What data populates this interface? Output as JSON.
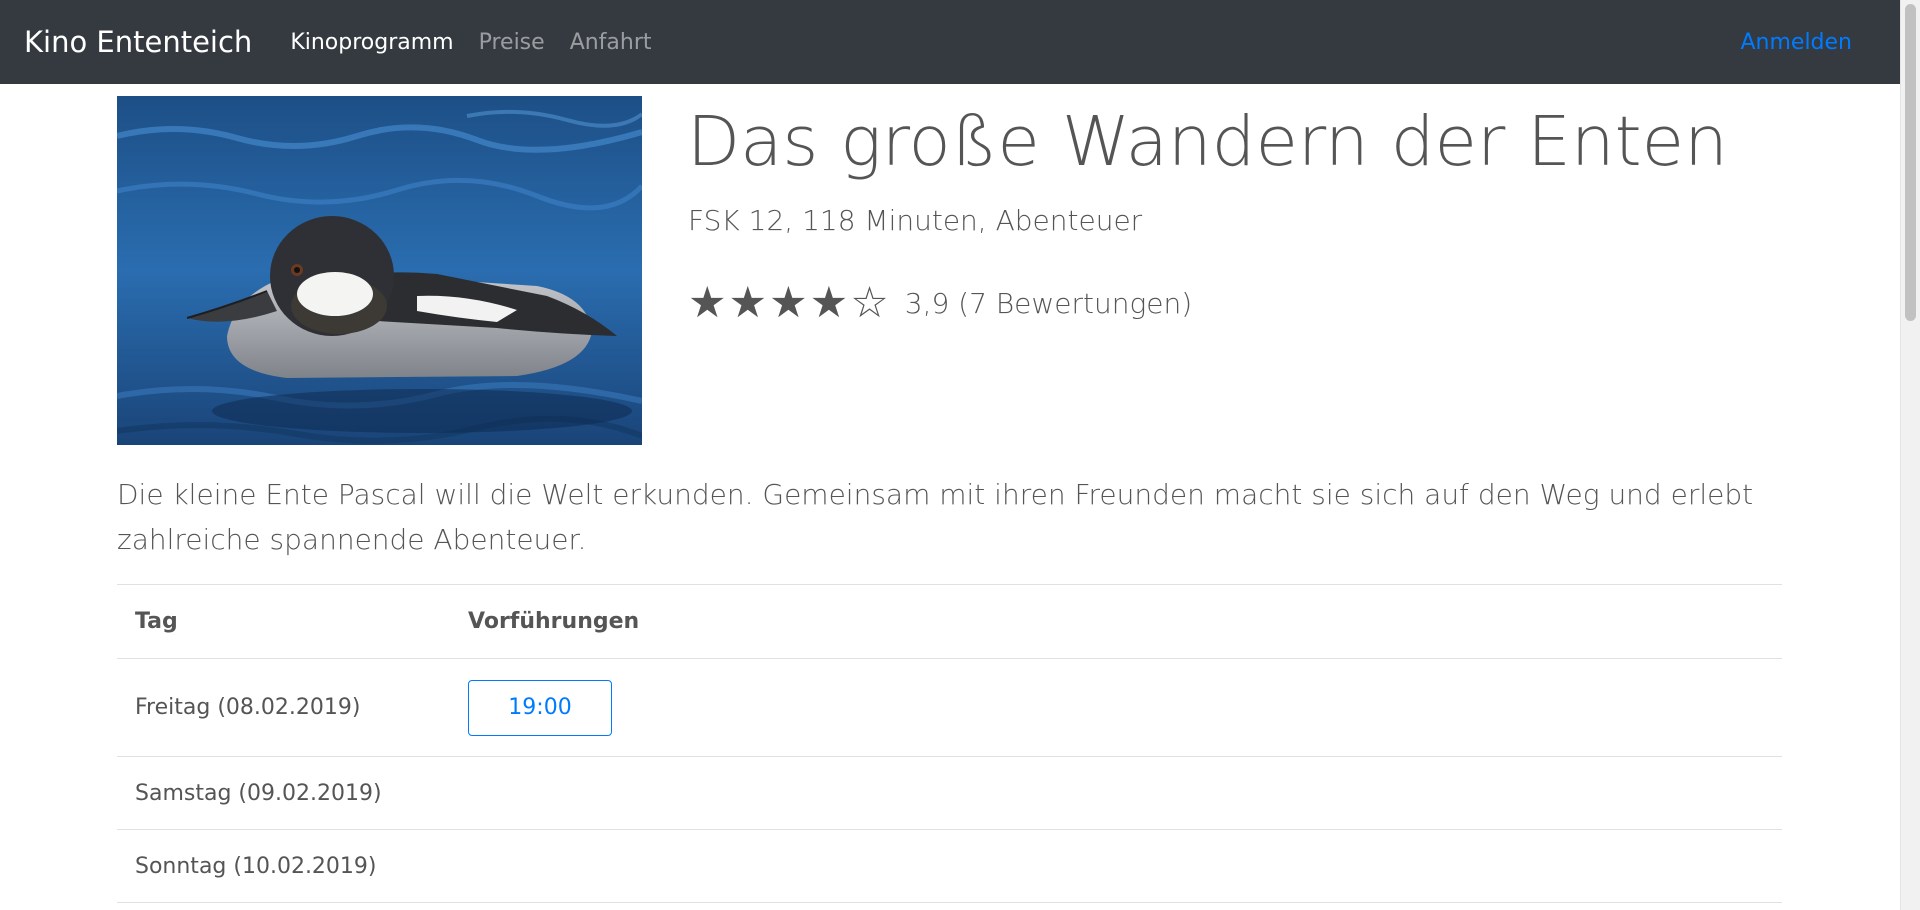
{
  "navbar": {
    "brand": "Kino Ententeich",
    "links": [
      {
        "label": "Kinoprogramm",
        "active": true
      },
      {
        "label": "Preise",
        "active": false
      },
      {
        "label": "Anfahrt",
        "active": false
      }
    ],
    "login": "Anmelden"
  },
  "movie": {
    "title": "Das große Wandern der Enten",
    "meta": "FSK 12, 118 Minuten, Abenteuer",
    "rating": {
      "value": 3.9,
      "max": 5,
      "stars": "★★★★☆",
      "text": "3,9 (7 Bewertungen)"
    },
    "description": "Die kleine Ente Pascal will die Welt erkunden. Gemeinsam mit ihren Freunden macht sie sich auf den Weg und erlebt zahlreiche spannende Abenteuer.",
    "poster_icon": "duck-photo"
  },
  "schedule": {
    "headers": {
      "day": "Tag",
      "shows": "Vorführungen"
    },
    "rows": [
      {
        "day": "Freitag (08.02.2019)",
        "times": [
          "19:00"
        ]
      },
      {
        "day": "Samstag (09.02.2019)",
        "times": []
      },
      {
        "day": "Sonntag (10.02.2019)",
        "times": []
      }
    ]
  },
  "colors": {
    "navbar": "#343a40",
    "accent": "#007bff",
    "text": "#555555"
  }
}
